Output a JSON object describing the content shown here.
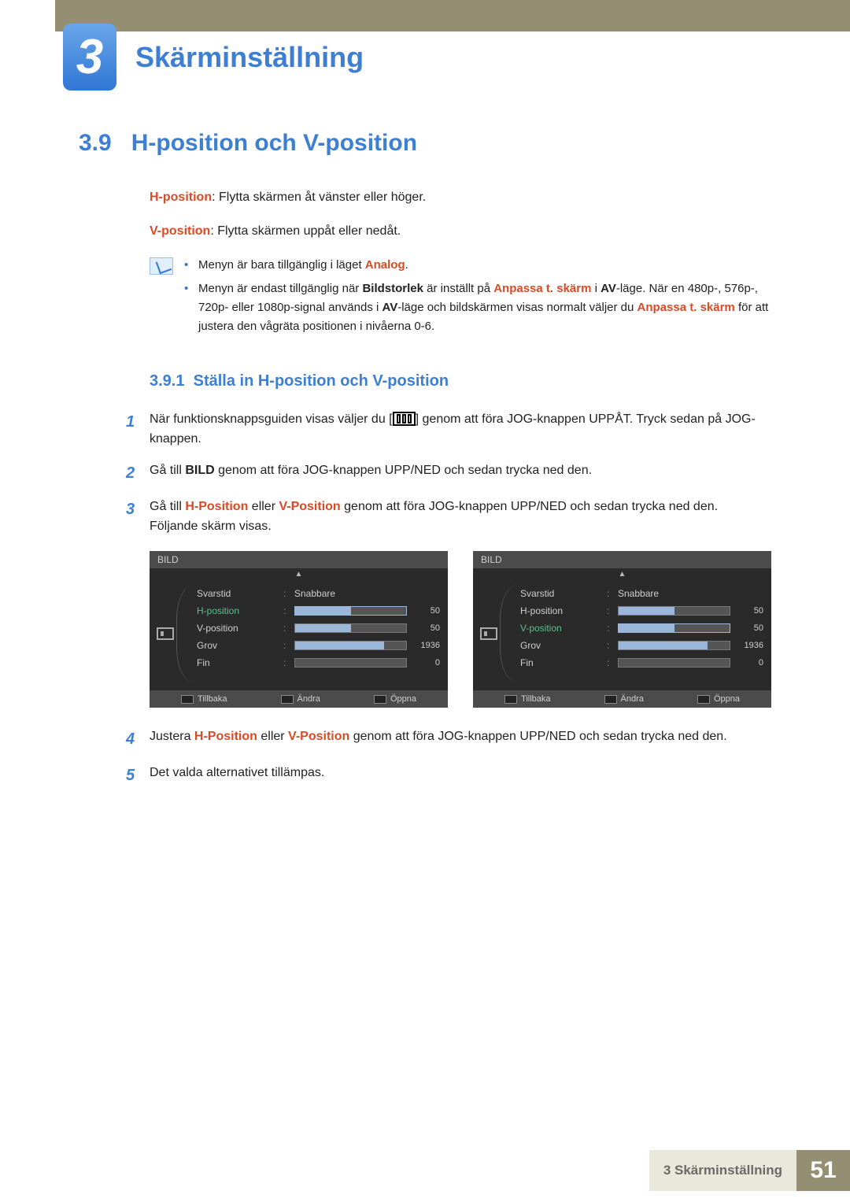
{
  "chapter": {
    "number": "3",
    "title": "Skärminställning"
  },
  "section": {
    "number": "3.9",
    "title": "H-position och V-position"
  },
  "defs": {
    "h_term": "H-position",
    "h_desc": ": Flytta skärmen åt vänster eller höger.",
    "v_term": "V-position",
    "v_desc": ": Flytta skärmen uppåt eller nedåt."
  },
  "notes": {
    "n1_a": "Menyn är bara tillgänglig i läget ",
    "n1_b": "Analog",
    "n1_c": ".",
    "n2_a": "Menyn är endast tillgänglig när ",
    "n2_b": "Bildstorlek",
    "n2_c": " är inställt på ",
    "n2_d": "Anpassa t. skärm",
    "n2_e": " i ",
    "n2_f": "AV",
    "n2_g": "-läge. När en 480p-, 576p-, 720p- eller 1080p-signal används i ",
    "n2_h": "AV",
    "n2_i": "-läge och bildskärmen visas normalt väljer du ",
    "n2_j": "Anpassa t. skärm",
    "n2_k": " för att justera den vågräta positionen i nivåerna 0-6."
  },
  "subsection": {
    "number": "3.9.1",
    "title": "Ställa in H-position och V-position"
  },
  "steps": {
    "s1_num": "1",
    "s1_a": "När funktionsknappsguiden visas väljer du [",
    "s1_b": "] genom att föra JOG-knappen UPPÅT. Tryck sedan på JOG-knappen.",
    "s2_num": "2",
    "s2_a": "Gå till ",
    "s2_b": "BILD",
    "s2_c": " genom att föra JOG-knappen UPP/NED och sedan trycka ned den.",
    "s3_num": "3",
    "s3_a": "Gå till ",
    "s3_b": "H-Position",
    "s3_c": " eller ",
    "s3_d": "V-Position",
    "s3_e": " genom att föra JOG-knappen UPP/NED och sedan trycka ned den.",
    "s3_f": "Följande skärm visas.",
    "s4_num": "4",
    "s4_a": "Justera ",
    "s4_b": "H-Position",
    "s4_c": " eller ",
    "s4_d": "V-Position",
    "s4_e": " genom att föra JOG-knappen UPP/NED och sedan trycka ned den.",
    "s5_num": "5",
    "s5_a": "Det valda alternativet tillämpas."
  },
  "osd": {
    "title": "BILD",
    "items": {
      "svarstid": "Svarstid",
      "hpos": "H-position",
      "vpos": "V-position",
      "grov": "Grov",
      "fin": "Fin"
    },
    "vals": {
      "snabbare": "Snabbare",
      "v50": "50",
      "v1936": "1936",
      "v0": "0"
    },
    "footer": {
      "back": "Tillbaka",
      "change": "Ändra",
      "open": "Öppna"
    }
  },
  "footer": {
    "label": "3 Skärminställning",
    "page": "51"
  }
}
